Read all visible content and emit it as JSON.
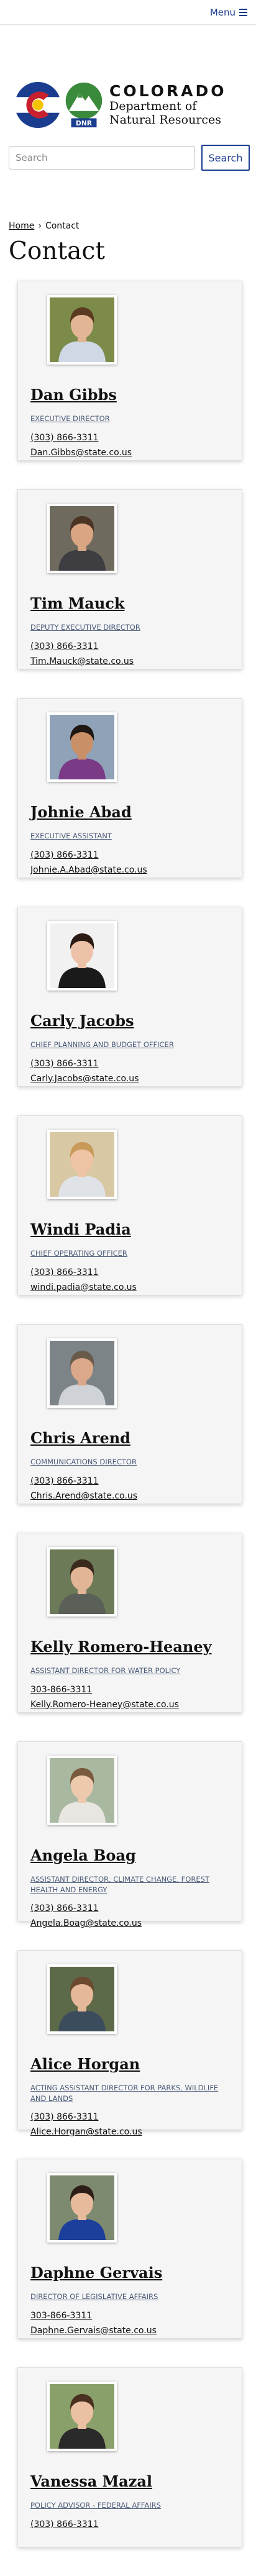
{
  "header": {
    "menu_label": "Menu"
  },
  "brand": {
    "state": "COLORADO",
    "dept_line1": "Department of",
    "dept_line2": "Natural Resources",
    "dnr_badge": "DNR"
  },
  "search": {
    "placeholder": "Search",
    "button_label": "Search"
  },
  "breadcrumb": {
    "home": "Home",
    "separator": "›",
    "current": "Contact"
  },
  "page_title": "Contact",
  "colors": {
    "brand_blue": "#1a3d8f",
    "co_red": "#c8202f",
    "co_yellow": "#f5c400",
    "dnr_green": "#3a8a3c",
    "card_bg": "#f5f5f5"
  },
  "staff": [
    {
      "name": "Dan Gibbs",
      "role": "EXECUTIVE DIRECTOR",
      "phone": "(303) 866-3311",
      "email": "Dan.Gibbs@state.co.us",
      "photo": {
        "bg": "#7c8b4a",
        "skin": "#e2b595",
        "hair": "#5a3b22",
        "shirt": "#cfd9e6"
      }
    },
    {
      "name": "Tim Mauck",
      "role": "DEPUTY EXECUTIVE DIRECTOR",
      "phone": "(303) 866-3311",
      "email": "Tim.Mauck@state.co.us",
      "photo": {
        "bg": "#6f6a5e",
        "skin": "#d9a582",
        "hair": "#4a3424",
        "shirt": "#3d3d42"
      }
    },
    {
      "name": "Johnie Abad",
      "role": "EXECUTIVE ASSISTANT",
      "phone": "(303) 866-3311",
      "email": "Johnie.A.Abad@state.co.us",
      "photo": {
        "bg": "#8fa2b8",
        "skin": "#c99068",
        "hair": "#1e1712",
        "shirt": "#7a3a86"
      }
    },
    {
      "name": "Carly Jacobs",
      "role": "CHIEF PLANNING AND BUDGET OFFICER",
      "phone": "(303) 866-3311",
      "email": "Carly.Jacobs@state.co.us",
      "photo": {
        "bg": "#f1f1f1",
        "skin": "#edc2a8",
        "hair": "#2a1b14",
        "shirt": "#1a1a1a"
      }
    },
    {
      "name": "Windi Padia",
      "role": "CHIEF OPERATING OFFICER",
      "phone": "(303) 866-3311",
      "email": "windi.padia@state.co.us",
      "photo": {
        "bg": "#d8c8a4",
        "skin": "#efc4a4",
        "hair": "#c89a5a",
        "shirt": "#dfe2e6"
      }
    },
    {
      "name": "Chris Arend",
      "role": "COMMUNICATIONS DIRECTOR",
      "phone": "(303) 866-3311",
      "email": "Chris.Arend@state.co.us",
      "photo": {
        "bg": "#7d8488",
        "skin": "#dba889",
        "hair": "#6a5a4a",
        "shirt": "#cfd2d6"
      }
    },
    {
      "name": "Kelly Romero-Heaney",
      "role": "ASSISTANT DIRECTOR FOR WATER POLICY",
      "phone": "303-866-3311",
      "email": "Kelly.Romero-Heaney@state.co.us",
      "photo": {
        "bg": "#6c7a58",
        "skin": "#e3b597",
        "hair": "#3a2a1e",
        "shirt": "#5a5f58"
      }
    },
    {
      "name": "Angela Boag",
      "role": "ASSISTANT DIRECTOR, CLIMATE CHANGE, FOREST HEALTH AND ENERGY",
      "phone": "(303) 866-3311",
      "email": "Angela.Boag@state.co.us",
      "photo": {
        "bg": "#a9b8a0",
        "skin": "#edc9ad",
        "hair": "#7a5a3c",
        "shirt": "#e8e6e0"
      }
    },
    {
      "name": "Alice Horgan",
      "role": "ACTING ASSISTANT DIRECTOR FOR PARKS, WILDLIFE AND LANDS",
      "phone": "(303) 866-3311",
      "email": "Alice.Horgan@state.co.us",
      "photo": {
        "bg": "#5d6a4a",
        "skin": "#e6b89a",
        "hair": "#6b4a30",
        "shirt": "#3b4d5c"
      }
    },
    {
      "name": "Daphne Gervais",
      "role": "DIRECTOR OF LEGISLATIVE AFFAIRS",
      "phone": "303-866-3311",
      "email": "Daphne.Gervais@state.co.us",
      "photo": {
        "bg": "#7e8a70",
        "skin": "#e7ba9c",
        "hair": "#2c1e16",
        "shirt": "#1d3f9c"
      }
    },
    {
      "name": "Vanessa Mazal",
      "role": "POLICY ADVISOR - FEDERAL AFFAIRS",
      "phone": "(303) 866-3311",
      "email": "",
      "photo": {
        "bg": "#8aa06a",
        "skin": "#ecc1a3",
        "hair": "#4a3020",
        "shirt": "#2a2a2a"
      }
    }
  ]
}
